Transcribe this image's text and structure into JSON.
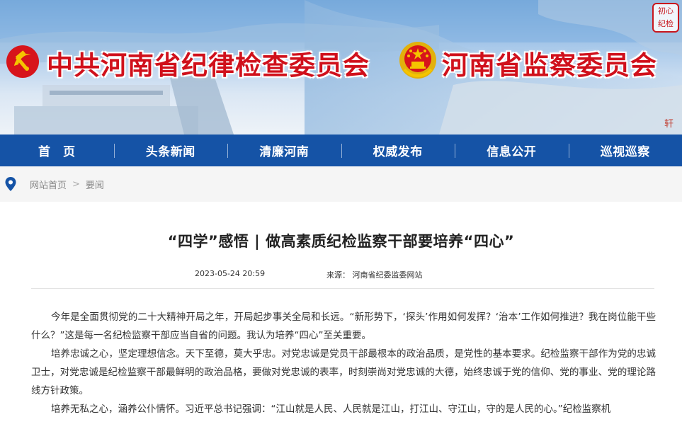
{
  "header": {
    "left_title": "中共河南省纪律检查委员会",
    "right_title": "河南省监察委员会",
    "seal_text": "初心·纪检",
    "corner_mark": "轩",
    "icons": {
      "left_emblem": "party-emblem-icon",
      "right_emblem": "national-emblem-icon"
    },
    "colors": {
      "title_red": "#d0101b",
      "nav_blue": "#1553a6"
    }
  },
  "nav": {
    "items": [
      "首　页",
      "头条新闻",
      "清廉河南",
      "权威发布",
      "信息公开",
      "巡视巡察"
    ]
  },
  "breadcrumb": {
    "icon": "location-pin-icon",
    "home": "网站首页",
    "separator": ">",
    "current": "要闻"
  },
  "article": {
    "title": "“四学”感悟 | 做高素质纪检监察干部要培养“四心”",
    "date": "2023-05-24 20:59",
    "source": "来源： 河南省纪委监委网站",
    "paragraphs": [
      "今年是全面贯彻党的二十大精神开局之年，开局起步事关全局和长远。“新形势下，‘探头’作用如何发挥？‘治本’工作如何推进？我在岗位能干些什么？”这是每一名纪检监察干部应当自省的问题。我认为培养“四心”至关重要。",
      "培养忠诚之心，坚定理想信念。天下至德，莫大乎忠。对党忠诚是党员干部最根本的政治品质，是党性的基本要求。纪检监察干部作为党的忠诚卫士，对党忠诚是纪检监察干部最鲜明的政治品格，要做对党忠诚的表率，时刻崇尚对党忠诚的大德，始终忠诚于党的信仰、党的事业、党的理论路线方针政策。",
      "培养无私之心，涵养公仆情怀。习近平总书记强调：“江山就是人民、人民就是江山，打江山、守江山，守的是人民的心。”纪检监察机"
    ]
  }
}
